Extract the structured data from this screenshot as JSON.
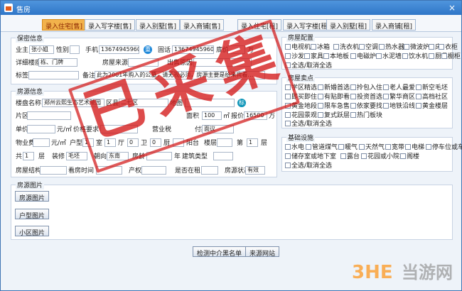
{
  "window": {
    "title": "售房",
    "close_icon": "×"
  },
  "tabs": [
    "录入住宅[售]",
    "录入写字楼[售]",
    "录入别墅[售]",
    "录入商铺[售]",
    "录入住宅[租]",
    "录入写字楼[租]",
    "录入别墅[租]",
    "录入商铺[租]"
  ],
  "sections": {
    "owner": "保密信息",
    "source": "房源信息",
    "config": "房屋配置",
    "selling": "房屋卖点",
    "facilities": "基础设施",
    "photos": "房源图片"
  },
  "owner": {
    "owner_label": "业主",
    "owner_name": "张小姐",
    "gender_label": "性别",
    "phone_label": "手机",
    "phone": "13674945960",
    "phone_icon": "重",
    "landline_label": "固话",
    "landline": "13674945960",
    "price_label": "底价",
    "price_unit": "万",
    "address_label": "详细楼座",
    "address": "栋、门牌",
    "source_label": "房屋来源",
    "selling_reason_label": "出售原因",
    "tag_label": "标签",
    "note_label": "备注",
    "note": "此为2001年购入的公墓，请无视必须，房源主要是给来宾看…"
  },
  "source_info": {
    "estate_label": "楼盘名称",
    "estate": "郑州云熙生态艺术陵园",
    "district_label": "区县",
    "district": "二七区",
    "map_label": "地图",
    "map_icon": "标",
    "area_label": "片区",
    "area_size_label": "面积",
    "area_size": "100",
    "area_unit": "㎡",
    "quote_label": "报价",
    "quote": "16500",
    "quote_unit": "万",
    "unit_price_label": "单价",
    "unit_price_unit": "元/㎡",
    "price_req_label": "价格要求",
    "business_tax_label": "营业税",
    "payment_label": "付款方式",
    "payment": "面议",
    "property_fee_label": "物业费",
    "property_fee_unit": "元/㎡",
    "layout_label": "户型",
    "room_label": "室",
    "room": "1",
    "hall_label": "厅",
    "hall": "1",
    "bath_label": "卫",
    "bath": "0",
    "kitchen_label": "厨",
    "kitchen": "0",
    "balcony_label": "阳台",
    "floor_label": "楼层",
    "floor_of_label": "第",
    "floor_num": "1",
    "floor_unit": "层",
    "total_floor_label": "共",
    "total_floor": "1",
    "floor_unit2": "层",
    "decor_label": "装修",
    "decor": "毛坯",
    "facing_label": "朝向",
    "facing": "东南",
    "age_label": "房龄",
    "year_unit": "年",
    "build_type_label": "建筑类型",
    "structure_label": "房屋结构",
    "view_time_label": "看房时间",
    "ownership_label": "产权",
    "rented_label": "是否在租",
    "status_label": "房源状态",
    "status": "有效"
  },
  "config_items": [
    "电视机",
    "冰箱",
    "洗衣机",
    "空调",
    "热水器",
    "微波炉",
    "床",
    "衣柜",
    "沙发",
    "家具",
    "本地板",
    "电磁炉",
    "水泥墙",
    "饮水机",
    "厨具",
    "橱柜"
  ],
  "config_footer": "全选/取消全选",
  "selling_items": [
    "学区精选",
    "新婚首选",
    "拎包入住",
    "老人最爱",
    "新空毛坯",
    "即买即住",
    "有贴即看",
    "投资首选",
    "繁华商区",
    "高档社区",
    "黄金地段",
    "限车急售",
    "依家要找",
    "地铁沿线",
    "黄金楼层",
    "花园景观",
    "复式跃层",
    "热门板块"
  ],
  "selling_footer": "全选/取消全选",
  "facility_items": [
    "水电",
    "管道煤气",
    "暖气",
    "天然气",
    "宽带",
    "电梯",
    "停车位或车库",
    "储存室或地下室",
    "露台",
    "花园或小院",
    "阁楼"
  ],
  "facility_footer": "全选/取消全选",
  "photo_buttons": [
    "房源图片",
    "户型图片",
    "小区图片"
  ],
  "footer_buttons": [
    "检测中介黑名单",
    "来源网站"
  ],
  "stamp_text": [
    "已",
    "采",
    "集"
  ],
  "watermark": {
    "badge": "3HE",
    "text": "当游网"
  }
}
